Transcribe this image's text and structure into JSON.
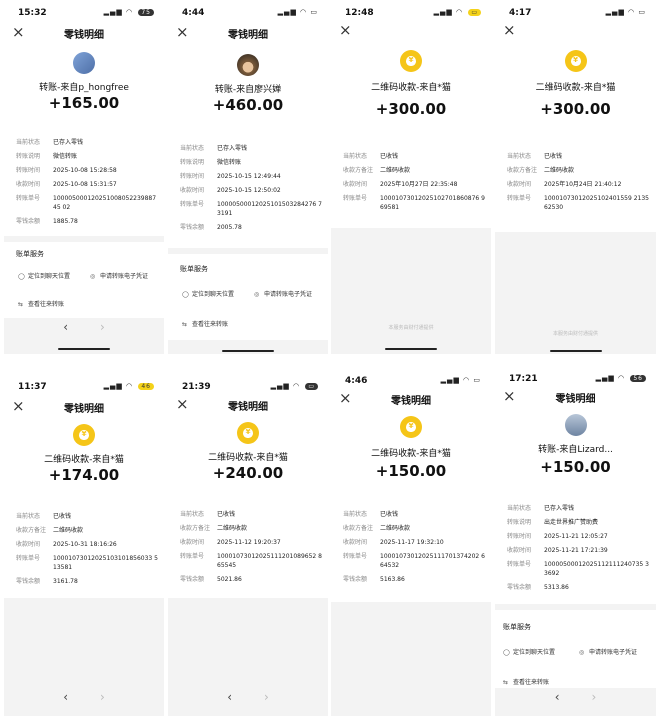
{
  "shared": {
    "page_title": "零钱明细",
    "close_glyph": "×",
    "prev_glyph": "‹",
    "next_glyph": "›",
    "battery_level": "75",
    "service_title": "账单服务",
    "svc_locate": "定位到聊天位置",
    "svc_apply": "申请转账电子凭证",
    "svc_history": "查看往来转账",
    "footer_note": "本服务由财付通提供",
    "icons": [
      "close-icon",
      "money-bag-icon",
      "chat-icon",
      "document-icon",
      "transfer-icon"
    ],
    "accent_color": "#f5c518"
  },
  "panels": [
    {
      "time": "15:32",
      "battery": "75",
      "sender": "转账-来自p_hongfree",
      "amount": "+165.00",
      "rows": [
        {
          "k": "当前状态",
          "v": "已存入零钱"
        },
        {
          "k": "转账说明",
          "v": "微信转账"
        },
        {
          "k": "转账时间",
          "v": "2025-10-08 15:28:58"
        },
        {
          "k": "收款时间",
          "v": "2025-10-08 15:31:57"
        },
        {
          "k": "转账单号",
          "v": "10000500012025100805223988745 02"
        },
        {
          "k": "零钱余额",
          "v": "1885.78"
        }
      ]
    },
    {
      "time": "4:44",
      "sender": "转账-来自廖兴婵",
      "amount": "+460.00",
      "rows": [
        {
          "k": "当前状态",
          "v": "已存入零钱"
        },
        {
          "k": "转账说明",
          "v": "微信转账"
        },
        {
          "k": "转账时间",
          "v": "2025-10-15 12:49:44"
        },
        {
          "k": "收款时间",
          "v": "2025-10-15 12:50:02"
        },
        {
          "k": "转账单号",
          "v": "10000500012025101503284276 73191"
        },
        {
          "k": "零钱余额",
          "v": "2005.78"
        }
      ]
    },
    {
      "time": "12:48",
      "sender": "二维码收款-来自*猫",
      "amount": "+300.00",
      "rows": [
        {
          "k": "当前状态",
          "v": "已收钱"
        },
        {
          "k": "收款方备注",
          "v": "二维码收款"
        },
        {
          "k": "收款时间",
          "v": "2025年10月27日 22:35:48"
        },
        {
          "k": "转账单号",
          "v": "10001073012025102701860876 969581"
        }
      ]
    },
    {
      "time": "4:17",
      "sender": "二维码收款-来自*猫",
      "amount": "+300.00",
      "rows": [
        {
          "k": "当前状态",
          "v": "已收钱"
        },
        {
          "k": "收款方备注",
          "v": "二维码收款"
        },
        {
          "k": "收款时间",
          "v": "2025年10月24日 21:40:12"
        },
        {
          "k": "转账单号",
          "v": "10001073012025102401559 213562530"
        }
      ]
    },
    {
      "time": "11:37",
      "battery": "46",
      "sender": "二维码收款-来自*猫",
      "amount": "+174.00",
      "rows": [
        {
          "k": "当前状态",
          "v": "已收钱"
        },
        {
          "k": "收款方备注",
          "v": "二维码收款"
        },
        {
          "k": "收款时间",
          "v": "2025-10-31 18:16:26"
        },
        {
          "k": "转账单号",
          "v": "10001073012025103101856033 513581"
        },
        {
          "k": "零钱余额",
          "v": "3161.78"
        }
      ]
    },
    {
      "time": "21:39",
      "sender": "二维码收款-来自*猫",
      "amount": "+240.00",
      "rows": [
        {
          "k": "当前状态",
          "v": "已收钱"
        },
        {
          "k": "收款方备注",
          "v": "二维码收款"
        },
        {
          "k": "收款时间",
          "v": "2025-11-12 19:20:37"
        },
        {
          "k": "转账单号",
          "v": "10001073012025111201089652 865545"
        },
        {
          "k": "零钱余额",
          "v": "5021.86"
        }
      ]
    },
    {
      "time": "4:46",
      "sender": "二维码收款-来自*猫",
      "amount": "+150.00",
      "rows": [
        {
          "k": "当前状态",
          "v": "已收钱"
        },
        {
          "k": "收款方备注",
          "v": "二维码收款"
        },
        {
          "k": "收款时间",
          "v": "2025-11-17 19:32:10"
        },
        {
          "k": "转账单号",
          "v": "10001073012025111701374202 664532"
        },
        {
          "k": "零钱余额",
          "v": "5163.86"
        }
      ]
    },
    {
      "time": "17:21",
      "battery": "56",
      "sender": "转账-来自Lizard...",
      "amount": "+150.00",
      "rows": [
        {
          "k": "当前状态",
          "v": "已存入零钱"
        },
        {
          "k": "转账说明",
          "v": "出走世界推广赞助费"
        },
        {
          "k": "转账时间",
          "v": "2025-11-21 12:05:27"
        },
        {
          "k": "收款时间",
          "v": "2025-11-21 17:21:39"
        },
        {
          "k": "转账单号",
          "v": "10000500012025112111240735 33692"
        },
        {
          "k": "零钱余额",
          "v": "5313.86"
        }
      ]
    }
  ]
}
